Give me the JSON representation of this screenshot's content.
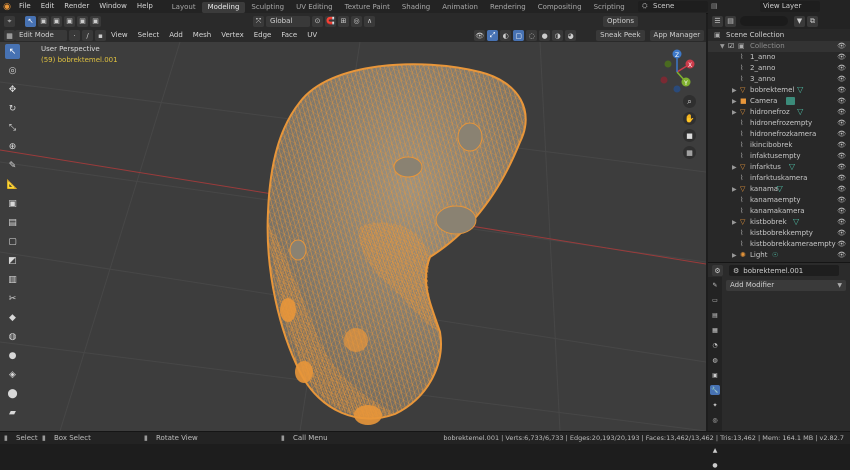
{
  "menubar": {
    "items": [
      "File",
      "Edit",
      "Render",
      "Window",
      "Help"
    ],
    "workspaces": [
      "Layout",
      "Modeling",
      "Sculpting",
      "UV Editing",
      "Texture Paint",
      "Shading",
      "Animation",
      "Rendering",
      "Compositing",
      "Scripting"
    ],
    "active_workspace": "Modeling",
    "scene_label": "Scene",
    "view_layer_label": "View Layer"
  },
  "viewport_header": {
    "mode": "Edit Mode",
    "menus": [
      "View",
      "Select",
      "Add",
      "Mesh",
      "Vertex",
      "Edge",
      "Face",
      "UV"
    ],
    "transform_orientation": "Global",
    "options_label": "Options",
    "sneak_peek_label": "Sneak Peek",
    "app_manager_label": "App Manager"
  },
  "viewport": {
    "perspective_label": "User Perspective",
    "object_label": "(59) bobrektemel.001",
    "axis_labels": {
      "x": "X",
      "y": "Y",
      "z": "Z"
    }
  },
  "outliner": {
    "title": "Scene Collection",
    "collection": "Collection",
    "items": [
      {
        "name": "1_anno",
        "type": "empty"
      },
      {
        "name": "2_anno",
        "type": "empty"
      },
      {
        "name": "3_anno",
        "type": "empty"
      },
      {
        "name": "bobrektemel",
        "type": "mesh"
      },
      {
        "name": "Camera",
        "type": "camera"
      },
      {
        "name": "hidronefroz",
        "type": "mesh"
      },
      {
        "name": "hidronefrozempty",
        "type": "empty"
      },
      {
        "name": "hidronefrozkamera",
        "type": "empty"
      },
      {
        "name": "ikincibobrek",
        "type": "empty"
      },
      {
        "name": "infaktusempty",
        "type": "empty"
      },
      {
        "name": "infarktus",
        "type": "mesh"
      },
      {
        "name": "infarktuskamera",
        "type": "empty"
      },
      {
        "name": "kanama",
        "type": "mesh"
      },
      {
        "name": "kanamaempty",
        "type": "empty"
      },
      {
        "name": "kanamakamera",
        "type": "empty"
      },
      {
        "name": "kistbobrek",
        "type": "mesh"
      },
      {
        "name": "kistbobrekkempty",
        "type": "empty"
      },
      {
        "name": "kistbobrekkameraempty",
        "type": "empty"
      },
      {
        "name": "Light",
        "type": "light"
      }
    ]
  },
  "properties": {
    "object_name": "bobrektemel.001",
    "add_modifier_label": "Add Modifier"
  },
  "statusbar": {
    "select": "Select",
    "box_select": "Box Select",
    "rotate_view": "Rotate View",
    "call_menu": "Call Menu",
    "stats": "bobrektemel.001 | Verts:6,733/6,733 | Edges:20,193/20,193 | Faces:13,462/13,462 | Tris:13,462 | Mem: 164.1 MB | v2.82.7"
  },
  "colors": {
    "accent_blue": "#4772b3",
    "mesh_orange": "#e8963a",
    "viewport_bg": "#3d3d3d"
  }
}
